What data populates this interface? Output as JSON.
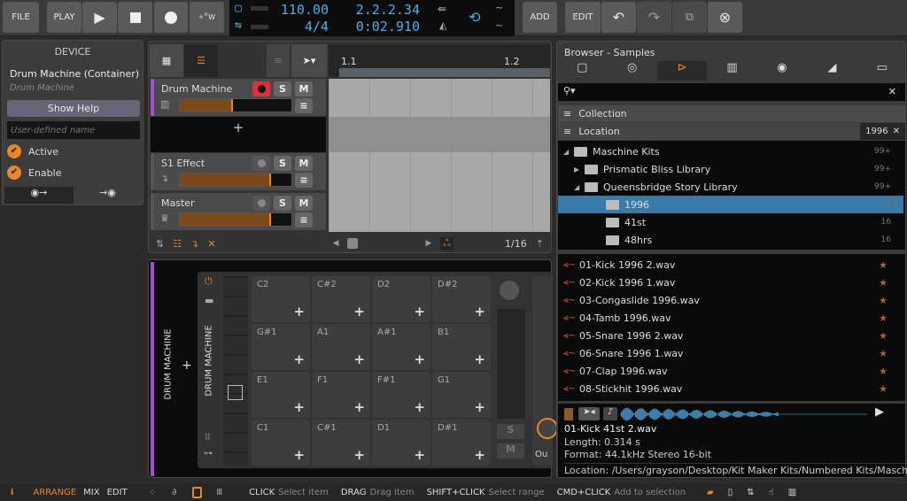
{
  "toolbar": {
    "file": "FILE",
    "play": "PLAY",
    "add": "ADD",
    "edit": "EDIT",
    "automation_w": "W"
  },
  "transport": {
    "tempo": "110.00",
    "time_signature": "4/4",
    "position_beats": "2.2.2.34",
    "position_time": "0:02.910",
    "accent": "#4ab0e8"
  },
  "device": {
    "title": "DEVICE",
    "name": "Drum Machine (Container)",
    "subtitle": "Drum Machine",
    "show_help": "Show Help",
    "name_placeholder": "User-defined name",
    "active": "Active",
    "enable": "Enable"
  },
  "tracks": [
    {
      "name": "Drum Machine",
      "level": 0.48,
      "color": "#a050d0",
      "armed": true
    },
    {
      "name": "S1 Effect",
      "level": 0.82
    },
    {
      "name": "Master",
      "level": 0.82
    }
  ],
  "track_buttons": {
    "solo": "S",
    "mute": "M"
  },
  "timeline": {
    "markers": [
      "1.1",
      "1.2"
    ],
    "grid": "1/16"
  },
  "drum_machine": {
    "chain_label": "DRUM MACHINE",
    "device_label": "DRUM MACHINE",
    "pads": [
      "C2",
      "C#2",
      "D2",
      "D#2",
      "G#1",
      "A1",
      "A#1",
      "B1",
      "E1",
      "F1",
      "F#1",
      "G1",
      "C1",
      "C#1",
      "D1",
      "D#1"
    ],
    "solo": "S",
    "mute": "M",
    "out": "Ou"
  },
  "browser": {
    "title": "Browser - Samples",
    "search_value": "",
    "collection": "Collection",
    "location": "Location",
    "location_filter": "1996",
    "tree": [
      {
        "name": "Maschine Kits",
        "count": "99+",
        "level": 0,
        "state": "open"
      },
      {
        "name": "Prismatic Bliss Library",
        "count": "99+",
        "level": 1,
        "state": "closed"
      },
      {
        "name": "Queensbridge Story Library",
        "count": "99+",
        "level": 1,
        "state": "open"
      },
      {
        "name": "1996",
        "count": "16",
        "level": 2,
        "selected": true
      },
      {
        "name": "41st",
        "count": "16",
        "level": 2
      },
      {
        "name": "48hrs",
        "count": "16",
        "level": 2
      }
    ],
    "files": [
      "01-Kick 1996 2.wav",
      "02-Kick 1996 1.wav",
      "03-Congaslide 1996.wav",
      "04-Tamb 1996.wav",
      "05-Snare 1996 2.wav",
      "06-Snare 1996 1.wav",
      "07-Clap 1996.wav",
      "08-Stickhit 1996.wav"
    ],
    "preview": {
      "file": "01-Kick 41st 2.wav",
      "length": "Length: 0.314 s",
      "format": "Format: 44.1kHz Stereo 16-bit",
      "location": "Location: /Users/grayson/Desktop/Kit Maker Kits/Numbered Kits/Maschin..."
    }
  },
  "status": {
    "modes": [
      "ARRANGE",
      "MIX",
      "EDIT"
    ],
    "active_mode": "ARRANGE",
    "hints": [
      {
        "key": "CLICK",
        "desc": "Select item"
      },
      {
        "key": "DRAG",
        "desc": "Drag item"
      },
      {
        "key": "SHIFT+CLICK",
        "desc": "Select range"
      },
      {
        "key": "CMD+CLICK",
        "desc": "Add to selection"
      }
    ]
  },
  "colors": {
    "accent": "#e8872a",
    "selection": "#3a7aa8",
    "record": "#e0303a"
  }
}
